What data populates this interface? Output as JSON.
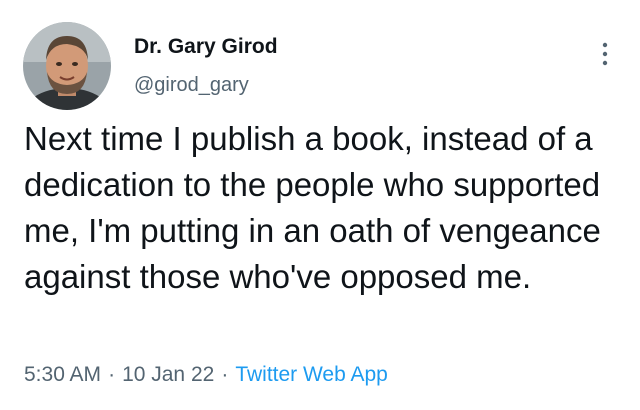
{
  "tweet": {
    "author": {
      "display_name": "Dr. Gary Girod",
      "handle": "@girod_gary",
      "avatar_icon": "user-avatar-photo"
    },
    "more_icon": "more-vertical-icon",
    "text": "Next time I publish a book, instead of a dedication to the people who supported me, I'm putting in an oath of vengeance against those who've opposed me.",
    "time": "5:30 AM",
    "date": "10 Jan 22",
    "separator": "·",
    "source": "Twitter Web App"
  },
  "colors": {
    "text_primary": "#0f1419",
    "text_secondary": "#536471",
    "link": "#1d9bf0",
    "background": "#ffffff"
  }
}
